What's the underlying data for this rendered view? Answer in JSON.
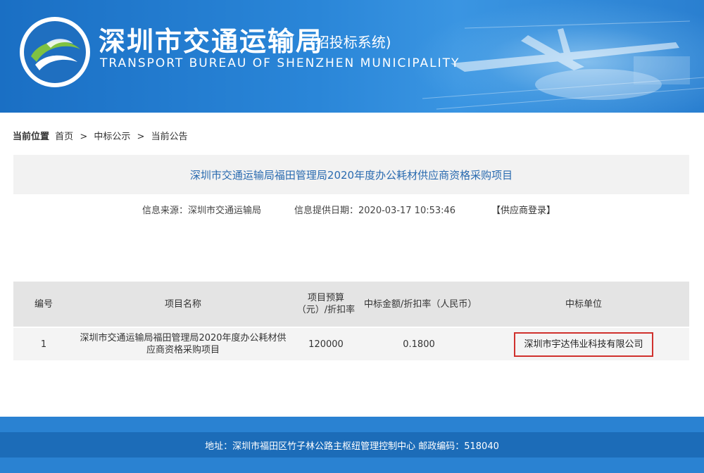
{
  "header": {
    "title": "深圳市交通运输局",
    "subtitle": "(招投标系统)",
    "title_en": "TRANSPORT BUREAU OF SHENZHEN MUNICIPALITY",
    "logo_text": "深圳市交通运输局"
  },
  "breadcrumb": {
    "label": "当前位置",
    "items": [
      "首页",
      "中标公示",
      "当前公告"
    ],
    "separator": ">"
  },
  "notice": {
    "title": "深圳市交通运输局福田管理局2020年度办公耗材供应商资格采购项目",
    "source": "信息来源：深圳市交通运输局",
    "date": "信息提供日期：2020-03-17 10:53:46",
    "login_link": "【供应商登录】"
  },
  "table": {
    "headers": [
      "编号",
      "项目名称",
      "项目预算（元）/折扣率",
      "中标金额/折扣率（人民币）",
      "中标单位"
    ],
    "rows": [
      {
        "no": "1",
        "name": "深圳市交通运输局福田管理局2020年度办公耗材供应商资格采购项目",
        "budget": "120000",
        "amount": "0.1800",
        "winner": "深圳市宇达伟业科技有限公司"
      }
    ]
  },
  "footer": {
    "address": "地址：深圳市福田区竹子林公路主枢纽管理控制中心 邮政编码：518040"
  },
  "colors": {
    "header_blue": "#1a6fc4",
    "title_blue": "#2a6bb0",
    "highlight_red": "#d0312d",
    "footer_blue": "#1c6cb8"
  }
}
